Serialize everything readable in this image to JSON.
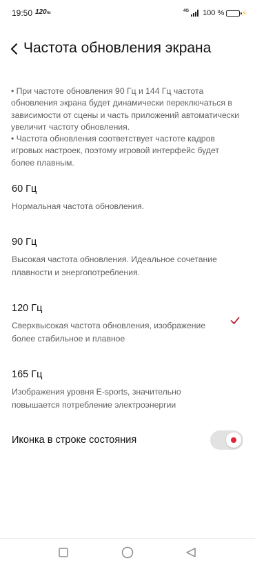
{
  "status_bar": {
    "time": "19:50",
    "refresh_rate": "120",
    "refresh_unit": "Hz",
    "network": "4G",
    "battery": "100 %",
    "battery_color": "#35c759",
    "charging_color": "#f5b400"
  },
  "header": {
    "back_icon": "chevron-left-icon",
    "title": "Частота обновления экрана"
  },
  "description": {
    "lines": [
      "• При частоте обновления 90 Гц и 144 Гц частота обновления экрана будет динамически переключаться в зависимости от сцены и часть приложений автоматически увеличит частоту обновления.",
      "• Частота обновления соответствует частоте кадров игровых настроек, поэтому игровой интерфейс будет более плавным."
    ]
  },
  "options": [
    {
      "title": "60 Гц",
      "description": "Нормальная частота обновления.",
      "selected": false
    },
    {
      "title": "90 Гц",
      "description": "Высокая частота обновления. Идеальное сочетание плавности и энергопотребления.",
      "selected": false
    },
    {
      "title": "120 Гц",
      "description": "Сверхвысокая частота обновления, изображение более стабильное и плавное",
      "selected": true
    },
    {
      "title": "165 Гц",
      "description": "Изображения уровня E-sports, значительно повышается потребление электроэнергии",
      "selected": false
    }
  ],
  "status_icon_setting": {
    "label": "Иконка в строке состояния",
    "enabled": true
  },
  "accent_color": "#b8283a",
  "toggle_dot_color": "#e0243b",
  "nav_bar": {
    "buttons": [
      "recent-apps-icon",
      "home-icon",
      "back-triangle-icon"
    ]
  }
}
